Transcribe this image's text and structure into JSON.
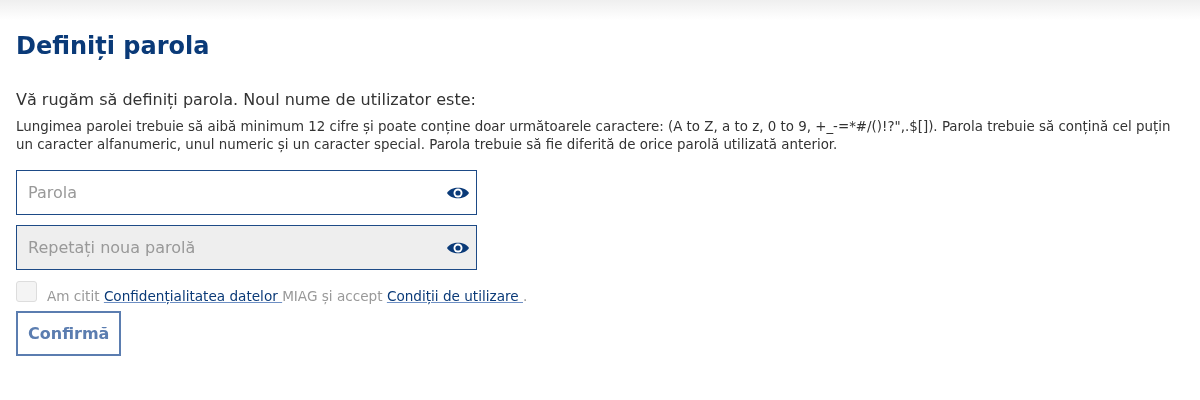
{
  "title": "Definiți parola",
  "intro": "Vă rugăm să definiți parola. Noul nume de utilizator este:",
  "rules": "Lungimea parolei trebuie să aibă minimum 12 cifre și poate conține doar următoarele caractere: (A to Z, a to z, 0 to 9, +_-=*#/()!?\",.$[]). Parola trebuie să conțină cel puțin un caracter alfanumeric, unul numeric și un caracter special. Parola trebuie să fie diferită de orice parolă utilizată anterior.",
  "fields": [
    {
      "placeholder": "Parola",
      "disabled": false
    },
    {
      "placeholder": "Repetați noua parolă",
      "disabled": true
    }
  ],
  "consent": {
    "checked": false,
    "disabled": true,
    "parts": [
      {
        "kind": "text",
        "text": "Am citit "
      },
      {
        "kind": "link",
        "text": "Confidențialitatea datelor "
      },
      {
        "kind": "text",
        "text": "MIAG și accept "
      },
      {
        "kind": "link",
        "text": "Condiții de utilizare "
      },
      {
        "kind": "text",
        "text": "."
      }
    ]
  },
  "submit": {
    "label": "Confirmă",
    "disabled": true
  }
}
